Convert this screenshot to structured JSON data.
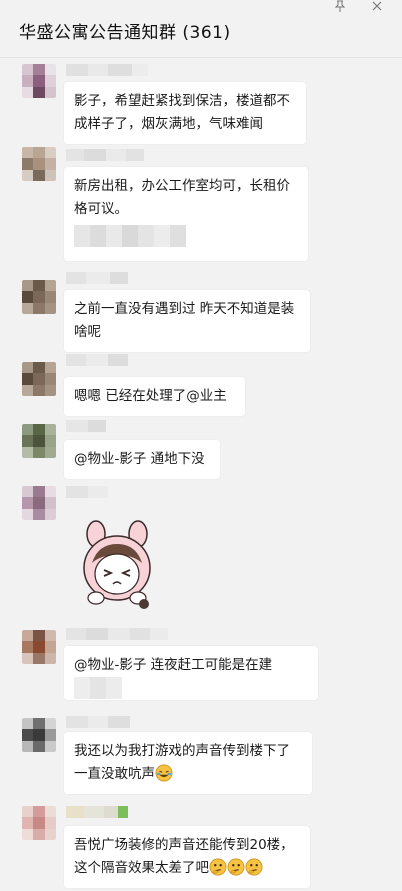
{
  "header": {
    "title": "华盛公寓公告通知群 (361)",
    "pin_icon": "pin-icon",
    "close_icon": "close-icon"
  },
  "messages": [
    {
      "text": "影子，希望赶紧找到保洁，楼道都不成样子了，烟灰满地，气味难闻"
    },
    {
      "text": "新房出租，办公工作室均可，长租价格可议。"
    },
    {
      "text": "之前一直没有遇到过 昨天不知道是装啥呢"
    },
    {
      "text": "嗯嗯 已经在处理了@业主"
    },
    {
      "text": "@物业-影子 通地下没"
    },
    {
      "sticker": "cartoon-girl-bunny-hood-sticker"
    },
    {
      "text": "@物业-影子 连夜赶工可能是在建"
    },
    {
      "text": "我还以为我打游戏的声音传到楼下了一直没敢吭声",
      "emoji": "laughing-tears-emoji"
    },
    {
      "text": "吾悦广场装修的声音还能传到20楼，这个隔音效果太差了吧",
      "emoji": "thinking-emoji"
    }
  ],
  "colors": {
    "background": "#f2f2f2",
    "bubble": "#ffffff",
    "text": "#1a1a1a"
  }
}
